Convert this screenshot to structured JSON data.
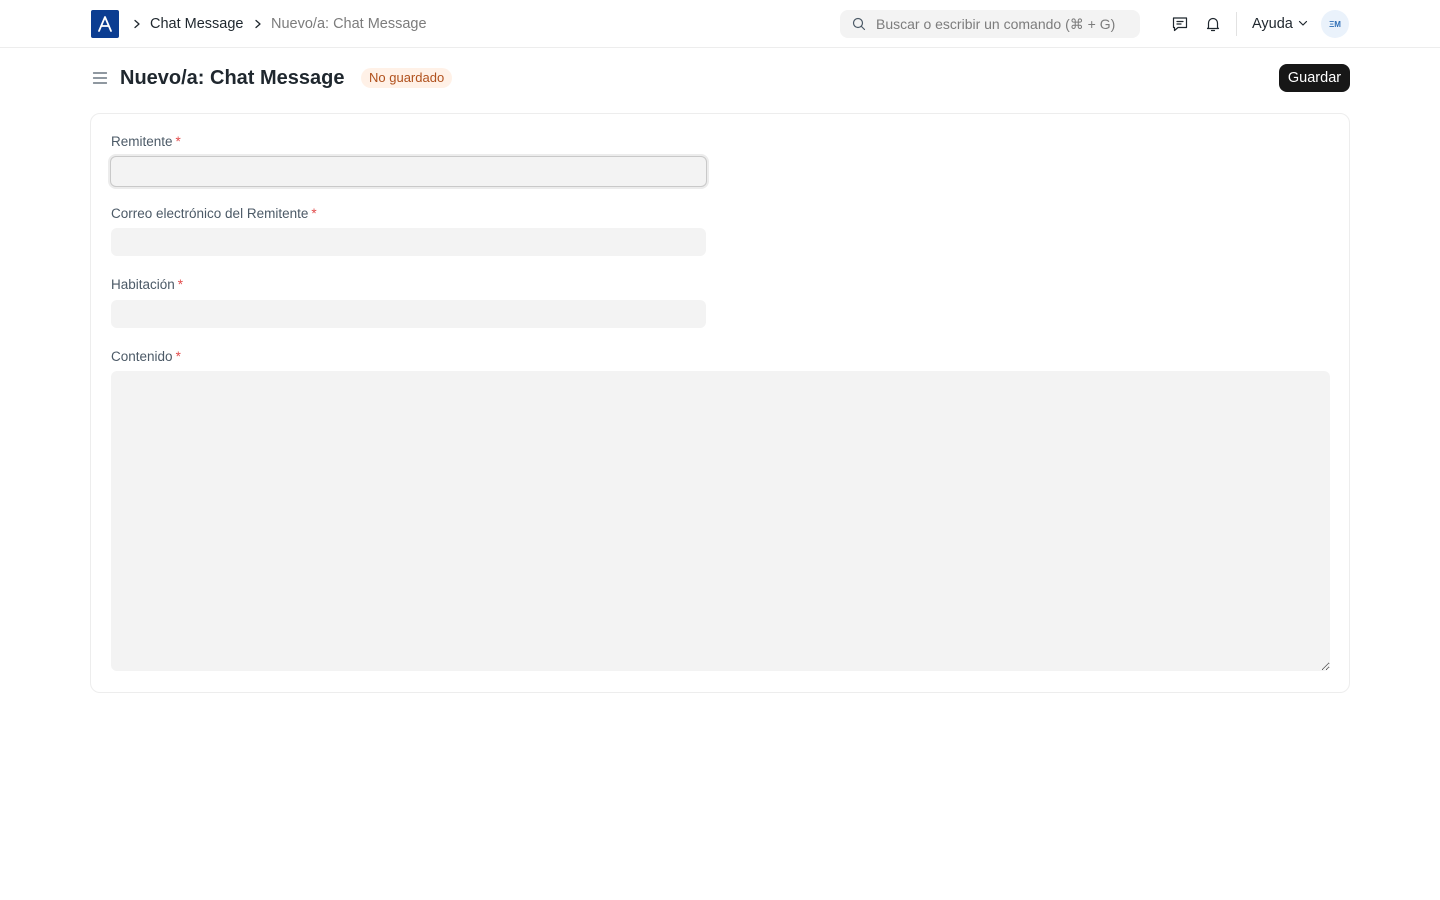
{
  "navbar": {
    "breadcrumbs": [
      "Chat Message",
      "Nuevo/a: Chat Message"
    ],
    "search_placeholder": "Buscar o escribir un comando (⌘ + G)",
    "help_label": "Ayuda",
    "avatar_initials": "ΞΜ"
  },
  "page": {
    "title": "Nuevo/a: Chat Message",
    "status": "No guardado",
    "save_label": "Guardar"
  },
  "form": {
    "fields": [
      {
        "label": "Remitente",
        "value": ""
      },
      {
        "label": "Correo electrónico del Remitente",
        "value": ""
      },
      {
        "label": "Habitación",
        "value": ""
      },
      {
        "label": "Contenido",
        "value": ""
      }
    ]
  },
  "colors": {
    "brand": "#0b3d91",
    "badge_bg": "#fff1e7",
    "badge_text": "#b0501c",
    "primary_button": "#171717",
    "required": "#e24c4c"
  }
}
